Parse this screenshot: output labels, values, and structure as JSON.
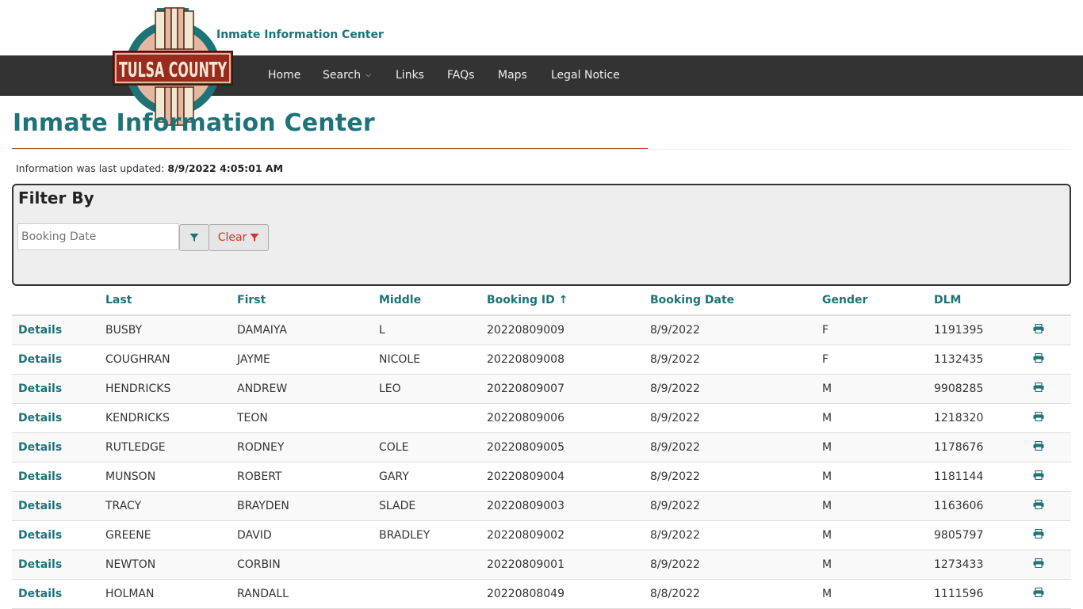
{
  "header": {
    "site_title": "Inmate Information Center",
    "logo_text": "TULSA COUNTY"
  },
  "nav": {
    "items": [
      {
        "label": "Home"
      },
      {
        "label": "Search"
      },
      {
        "label": "Links"
      },
      {
        "label": "FAQs"
      },
      {
        "label": "Maps"
      },
      {
        "label": "Legal Notice"
      }
    ]
  },
  "page": {
    "title": "Inmate Information Center",
    "updated_prefix": "Information was last updated:",
    "updated_value": "8/9/2022 4:05:01 AM"
  },
  "filter": {
    "title": "Filter By",
    "placeholder": "Booking Date",
    "clear_label": "Clear"
  },
  "table": {
    "headers": {
      "last": "Last",
      "first": "First",
      "middle": "Middle",
      "booking_id": "Booking ID ↑",
      "booking_date": "Booking Date",
      "gender": "Gender",
      "dlm": "DLM"
    },
    "details_label": "Details",
    "rows": [
      {
        "last": "BUSBY",
        "first": "DAMAIYA",
        "middle": "L",
        "booking_id": "20220809009",
        "booking_date": "8/9/2022",
        "gender": "F",
        "dlm": "1191395"
      },
      {
        "last": "COUGHRAN",
        "first": "JAYME",
        "middle": "NICOLE",
        "booking_id": "20220809008",
        "booking_date": "8/9/2022",
        "gender": "F",
        "dlm": "1132435"
      },
      {
        "last": "HENDRICKS",
        "first": "ANDREW",
        "middle": "LEO",
        "booking_id": "20220809007",
        "booking_date": "8/9/2022",
        "gender": "M",
        "dlm": "9908285"
      },
      {
        "last": "KENDRICKS",
        "first": "TEON",
        "middle": "",
        "booking_id": "20220809006",
        "booking_date": "8/9/2022",
        "gender": "M",
        "dlm": "1218320"
      },
      {
        "last": "RUTLEDGE",
        "first": "RODNEY",
        "middle": "COLE",
        "booking_id": "20220809005",
        "booking_date": "8/9/2022",
        "gender": "M",
        "dlm": "1178676"
      },
      {
        "last": "MUNSON",
        "first": "ROBERT",
        "middle": "GARY",
        "booking_id": "20220809004",
        "booking_date": "8/9/2022",
        "gender": "M",
        "dlm": "1181144"
      },
      {
        "last": "TRACY",
        "first": "BRAYDEN",
        "middle": "SLADE",
        "booking_id": "20220809003",
        "booking_date": "8/9/2022",
        "gender": "M",
        "dlm": "1163606"
      },
      {
        "last": "GREENE",
        "first": "DAVID",
        "middle": "BRADLEY",
        "booking_id": "20220809002",
        "booking_date": "8/9/2022",
        "gender": "M",
        "dlm": "9805797"
      },
      {
        "last": "NEWTON",
        "first": "CORBIN",
        "middle": "",
        "booking_id": "20220809001",
        "booking_date": "8/9/2022",
        "gender": "M",
        "dlm": "1273433"
      },
      {
        "last": "HOLMAN",
        "first": "RANDALL",
        "middle": "",
        "booking_id": "20220808049",
        "booking_date": "8/8/2022",
        "gender": "M",
        "dlm": "1111596"
      }
    ]
  },
  "colors": {
    "accent": "#1d7378",
    "nav_bg": "#333333",
    "title_rule": "#b1522c",
    "clear": "#d9302c"
  },
  "icons": {
    "filter": "filter-icon",
    "print": "print-icon",
    "caret": "chevron-down-icon"
  }
}
